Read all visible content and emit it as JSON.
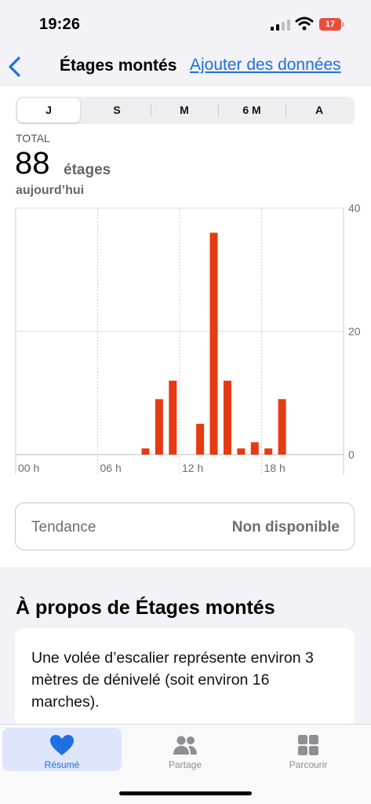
{
  "status": {
    "time": "19:26",
    "battery": "17"
  },
  "nav": {
    "title": "Étages montés",
    "action": "Ajouter des données"
  },
  "segments": [
    {
      "label": "J",
      "active": true
    },
    {
      "label": "S",
      "active": false
    },
    {
      "label": "M",
      "active": false
    },
    {
      "label": "6 M",
      "active": false
    },
    {
      "label": "A",
      "active": false
    }
  ],
  "summary": {
    "label": "TOTAL",
    "value": "88",
    "unit": "étages",
    "date": "aujourd’hui"
  },
  "chart_data": {
    "type": "bar",
    "x_ticks": [
      "00 h",
      "06 h",
      "12 h",
      "18 h"
    ],
    "y_ticks": [
      40,
      20,
      0
    ],
    "ylim": [
      0,
      40
    ],
    "x_range_hours": [
      0,
      24
    ],
    "bar_color": "#e63a12",
    "grid": true,
    "x": [
      9.5,
      10.5,
      11.5,
      13.5,
      14.5,
      15.5,
      16.5,
      17.5,
      18.5,
      19.5
    ],
    "values": [
      1,
      9,
      12,
      5,
      36,
      12,
      1,
      2,
      1,
      9
    ]
  },
  "trend": {
    "label": "Tendance",
    "value": "Non disponible"
  },
  "about": {
    "title": "À propos de Étages montés",
    "text": "Une volée d’escalier représente environ 3 mètres de dénivelé (soit environ 16 marches)."
  },
  "tabs": [
    {
      "label": "Résumé",
      "icon": "heart-icon",
      "active": true
    },
    {
      "label": "Partage",
      "icon": "people-icon",
      "active": false
    },
    {
      "label": "Parcourir",
      "icon": "grid-icon",
      "active": false
    }
  ],
  "colors": {
    "accent": "#1f6fe0",
    "bar": "#e63a12"
  }
}
